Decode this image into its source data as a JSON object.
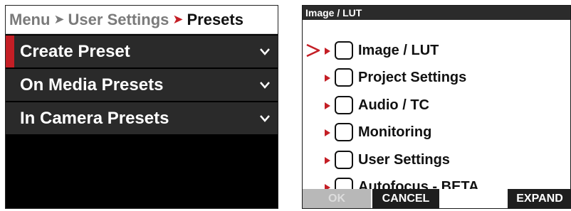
{
  "left": {
    "breadcrumb": {
      "menu": "Menu",
      "user_settings": "User Settings",
      "current": "Presets"
    },
    "items": [
      {
        "label": "Create Preset",
        "selected": true
      },
      {
        "label": "On Media Presets",
        "selected": false
      },
      {
        "label": "In Camera Presets",
        "selected": false
      }
    ],
    "accent_color": "#c41e25"
  },
  "right": {
    "title": "Image / LUT",
    "tree": [
      {
        "label": "Image / LUT",
        "focused": true,
        "checked": false
      },
      {
        "label": "Project Settings",
        "focused": false,
        "checked": false
      },
      {
        "label": "Audio / TC",
        "focused": false,
        "checked": false
      },
      {
        "label": "Monitoring",
        "focused": false,
        "checked": false
      },
      {
        "label": "User Settings",
        "focused": false,
        "checked": false
      },
      {
        "label": "Autofocus - BETA",
        "focused": false,
        "checked": false
      }
    ],
    "buttons": {
      "ok": "OK",
      "cancel": "CANCEL",
      "expand": "EXPAND"
    }
  }
}
